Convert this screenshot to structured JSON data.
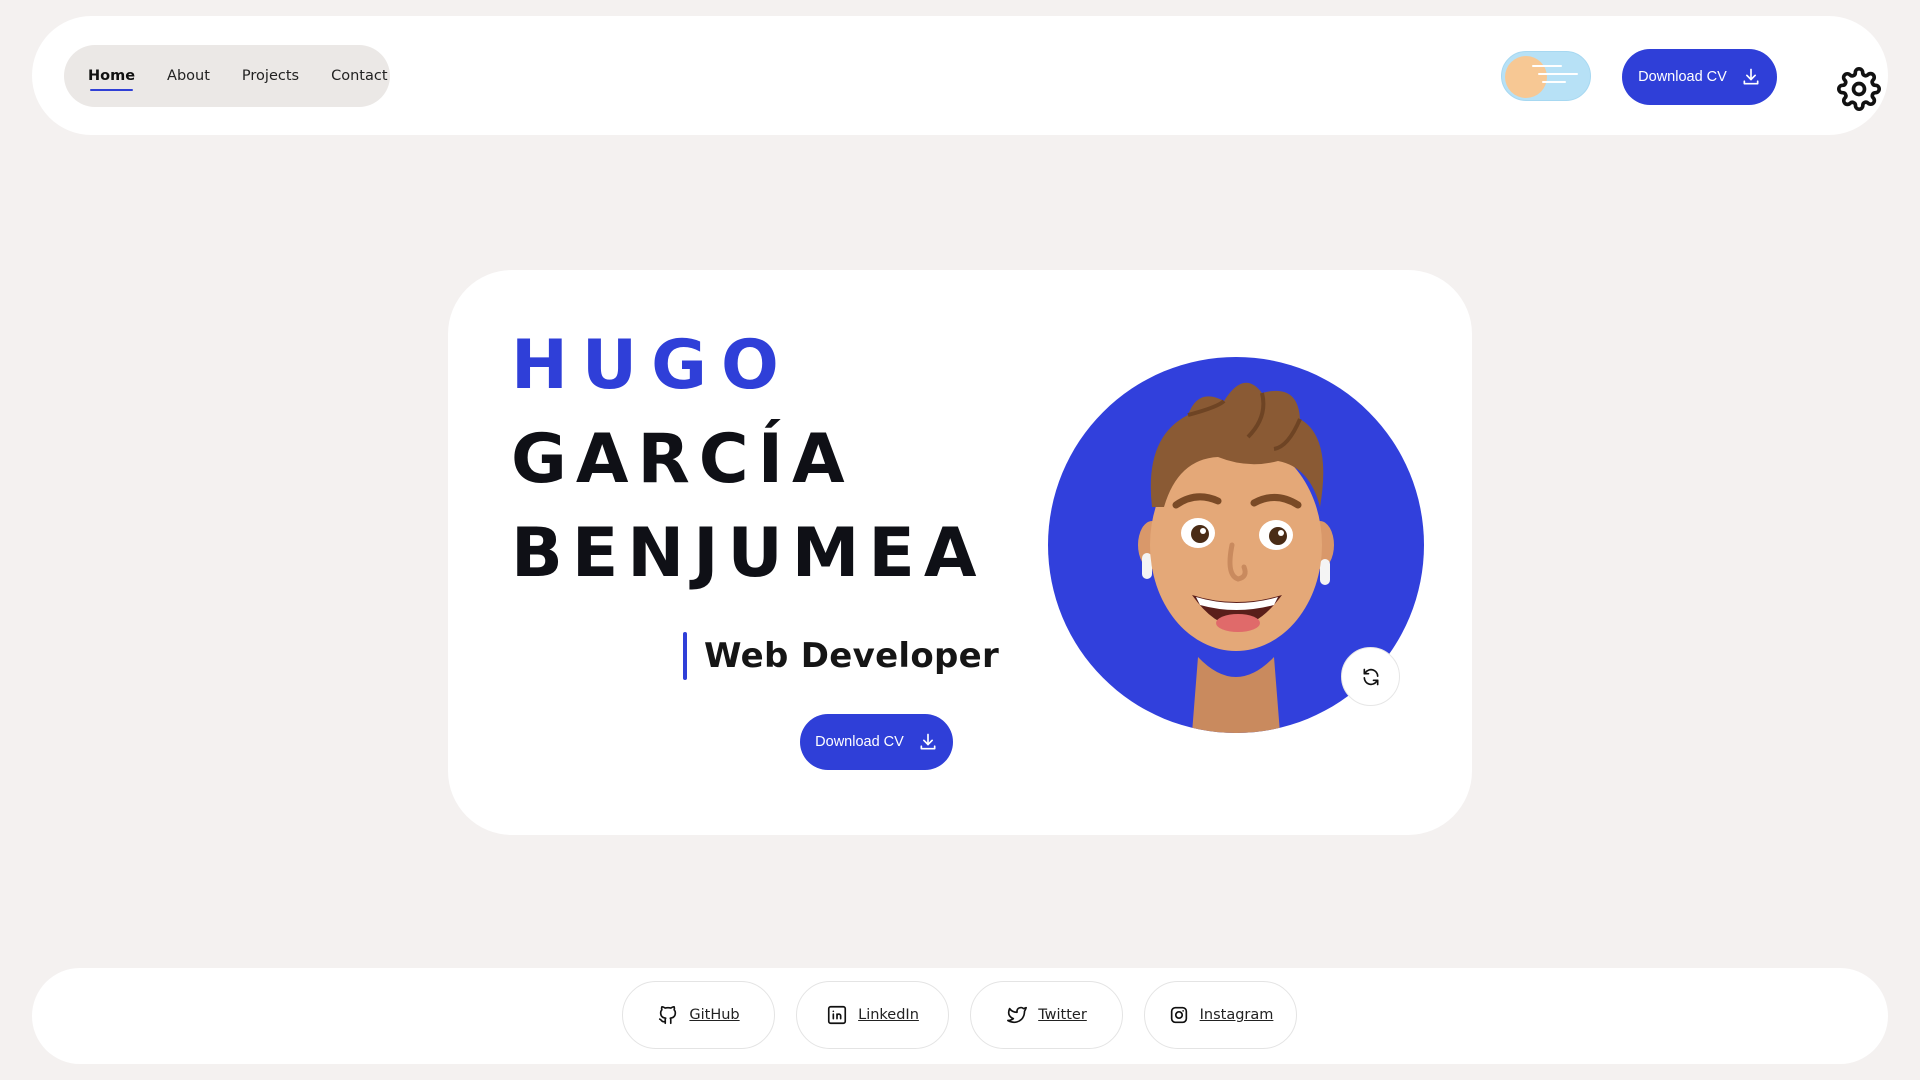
{
  "nav": {
    "items": [
      {
        "label": "Home",
        "active": true
      },
      {
        "label": "About",
        "active": false
      },
      {
        "label": "Projects",
        "active": false
      },
      {
        "label": "Contact",
        "active": false
      }
    ]
  },
  "header": {
    "theme_toggle_icon": "sun-icon",
    "download_label": "Download CV",
    "settings_icon": "gear-icon"
  },
  "hero": {
    "first_name": "HUGO",
    "middle_name": "GARCÍA",
    "last_name": "BENJUMEA",
    "role": "Web Developer",
    "download_label": "Download CV",
    "avatar_icon": "memoji-avatar",
    "refresh_icon": "refresh-icon"
  },
  "footer": {
    "socials": [
      {
        "label": "GitHub",
        "icon": "github-icon"
      },
      {
        "label": "LinkedIn",
        "icon": "linkedin-icon"
      },
      {
        "label": "Twitter",
        "icon": "twitter-icon"
      },
      {
        "label": "Instagram",
        "icon": "instagram-icon"
      }
    ]
  },
  "colors": {
    "accent": "#2f3fd8",
    "background": "#f4f1f0",
    "toggle": "#b7e1f6",
    "sun": "#f7c894"
  }
}
